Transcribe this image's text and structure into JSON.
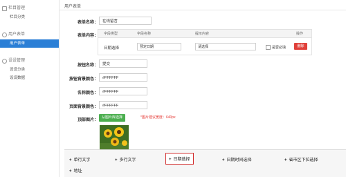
{
  "sidebar": {
    "groups": [
      {
        "title": "栏目管理",
        "items": [
          {
            "label": "栏目分类",
            "active": false
          }
        ]
      },
      {
        "title": "用户表单",
        "items": [
          {
            "label": "用户表单",
            "active": true
          }
        ]
      },
      {
        "title": "设设管理",
        "items": [
          {
            "label": "设设分类",
            "active": false
          },
          {
            "label": "设设数据",
            "active": false
          }
        ]
      }
    ]
  },
  "main": {
    "breadcrumb": "用户表单",
    "form_name": {
      "label": "表单名称：",
      "value": "在线留言"
    },
    "form_content": {
      "label": "表单内容：",
      "columns": [
        "字段类型",
        "字段名称",
        "提示内容",
        "操作"
      ],
      "row": {
        "type": "日期选择",
        "name": "预定日期",
        "hint": "请选择",
        "required_label": "是否必填",
        "delete_label": "删除"
      }
    },
    "button_name": {
      "label": "按钮名称：",
      "value": "提交"
    },
    "button_bg": {
      "label": "按钮背景颜色：",
      "value": "#FFFFFF"
    },
    "name_color": {
      "label": "名称颜色：",
      "value": "#FFFFFF"
    },
    "page_bg": {
      "label": "页面背景颜色：",
      "value": "#FFFFFF"
    },
    "top_image": {
      "label": "顶部图片：",
      "button": "从图片库选择",
      "hint": "*图片建议宽度：640px"
    }
  },
  "popup": {
    "options": [
      "单行文字",
      "多行文字",
      "日期选择",
      "日期时间选择",
      "省市区下拉选择",
      "地址"
    ],
    "highlighted": "日期选择"
  },
  "colors": {
    "accent": "#2b7fd6",
    "danger": "#e0403a",
    "success": "#4caf50",
    "highlight": "#d32f2f"
  }
}
